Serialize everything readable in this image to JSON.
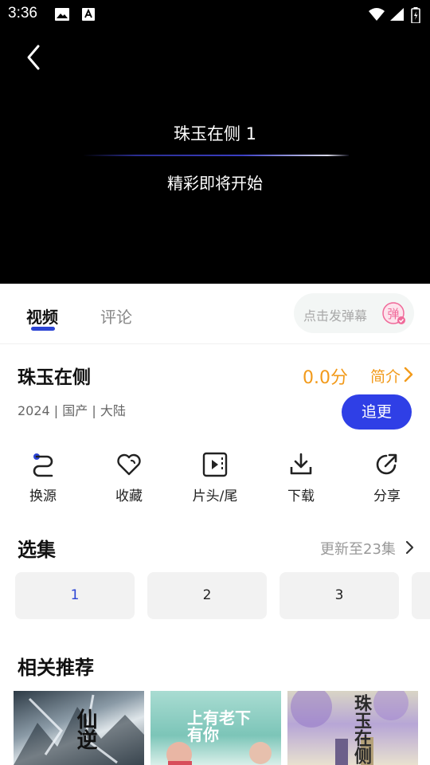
{
  "status_bar": {
    "time": "3:36"
  },
  "player": {
    "title": "珠玉在侧  1",
    "status": "精彩即将开始"
  },
  "tabs": {
    "video": "视频",
    "comments": "评论"
  },
  "danmaku": {
    "placeholder": "点击发弹幕",
    "icon_text": "弹"
  },
  "show": {
    "title": "珠玉在侧",
    "score": "0.0分",
    "intro_label": "简介",
    "meta": "2024 | 国产 | 大陆",
    "follow_label": "追更"
  },
  "actions": [
    {
      "label": "换源",
      "icon": "switch-source-icon"
    },
    {
      "label": "收藏",
      "icon": "heart-icon"
    },
    {
      "label": "片头/尾",
      "icon": "play-skip-icon"
    },
    {
      "label": "下载",
      "icon": "download-icon"
    },
    {
      "label": "分享",
      "icon": "share-icon"
    }
  ],
  "episodes": {
    "heading": "选集",
    "update_text": "更新至23集",
    "items": [
      "1",
      "2",
      "3"
    ],
    "selected": "1"
  },
  "recommendations": {
    "heading": "相关推荐",
    "posters": [
      {
        "text": "仙逆"
      },
      {
        "text": "上有老下有你"
      },
      {
        "text": "珠玉在侧"
      }
    ]
  },
  "colors": {
    "accent_blue": "#2f3fe6",
    "score_orange": "#f29a1a",
    "danmaku_pink": "#f06a9a"
  }
}
